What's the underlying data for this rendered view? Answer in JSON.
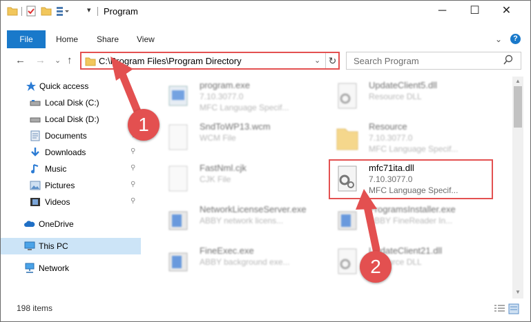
{
  "window": {
    "title": "Program",
    "controls": {
      "minimize": "─",
      "maximize": "☐",
      "close": "✕"
    }
  },
  "ribbon": {
    "tabs": [
      "File",
      "Home",
      "Share",
      "View"
    ],
    "expand_glyph": "⌄",
    "help_glyph": "?"
  },
  "navigation": {
    "back": "←",
    "forward": "→",
    "recent": "⌄",
    "up": "↑",
    "address": "C:\\Program Files\\Program Directory",
    "address_dropdown": "⌄",
    "refresh": "↻",
    "search_placeholder": "Search Program"
  },
  "sidebar": {
    "items": [
      {
        "label": "Quick access",
        "icon": "star-icon",
        "pinned": false
      },
      {
        "label": "Local Disk (C:)",
        "icon": "drive-icon",
        "pinned": false
      },
      {
        "label": "Local Disk (D:)",
        "icon": "drive-icon",
        "pinned": false
      },
      {
        "label": "Documents",
        "icon": "documents-icon",
        "pinned": true
      },
      {
        "label": "Downloads",
        "icon": "download-icon",
        "pinned": true
      },
      {
        "label": "Music",
        "icon": "music-icon",
        "pinned": true
      },
      {
        "label": "Pictures",
        "icon": "pictures-icon",
        "pinned": true
      },
      {
        "label": "Videos",
        "icon": "videos-icon",
        "pinned": true
      },
      {
        "label": "OneDrive",
        "icon": "cloud-icon",
        "pinned": false
      },
      {
        "label": "This PC",
        "icon": "computer-icon",
        "pinned": false,
        "selected": true
      },
      {
        "label": "Network",
        "icon": "network-icon",
        "pinned": false
      }
    ],
    "pin_glyph": "📌"
  },
  "files": [
    {
      "name": "program.exe",
      "line2": "7.10.3077.0",
      "line3": "MFC Language Specif...",
      "icon": "exe-icon"
    },
    {
      "name": "UpdateClient5.dll",
      "line2": "Resource DLL",
      "line3": "",
      "icon": "dll-icon"
    },
    {
      "name": "SndToWP13.wcm",
      "line2": "WCM File",
      "line3": "",
      "icon": "generic-file-icon"
    },
    {
      "name": "Resource",
      "line2": "7.10.3077.0",
      "line3": "MFC Language Specif...",
      "icon": "folder-icon"
    },
    {
      "name": "FastNml.cjk",
      "line2": "CJK File",
      "line3": "",
      "icon": "generic-file-icon"
    },
    {
      "name": "mfc71ita.dll",
      "line2": "7.10.3077.0",
      "line3": "MFC Language Specif...",
      "icon": "dll-icon",
      "highlighted": true
    },
    {
      "name": "NetworkLicenseServer.exe",
      "line2": "ABBY network licens...",
      "line3": "",
      "icon": "app-icon"
    },
    {
      "name": "ProgramsInstaller.exe",
      "line2": "ABBY FineReader In...",
      "line3": "",
      "icon": "app-icon"
    },
    {
      "name": "FineExec.exe",
      "line2": "ABBY background exe...",
      "line3": "",
      "icon": "app-icon"
    },
    {
      "name": "UpdateClient21.dll",
      "line2": "Resource DLL",
      "line3": "",
      "icon": "dll-icon"
    }
  ],
  "status": {
    "item_count": "198 items"
  },
  "annotations": {
    "badge1": "1",
    "badge2": "2"
  },
  "colors": {
    "accent": "#1979ca",
    "highlight": "#e35050",
    "selected": "#cce4f7"
  }
}
